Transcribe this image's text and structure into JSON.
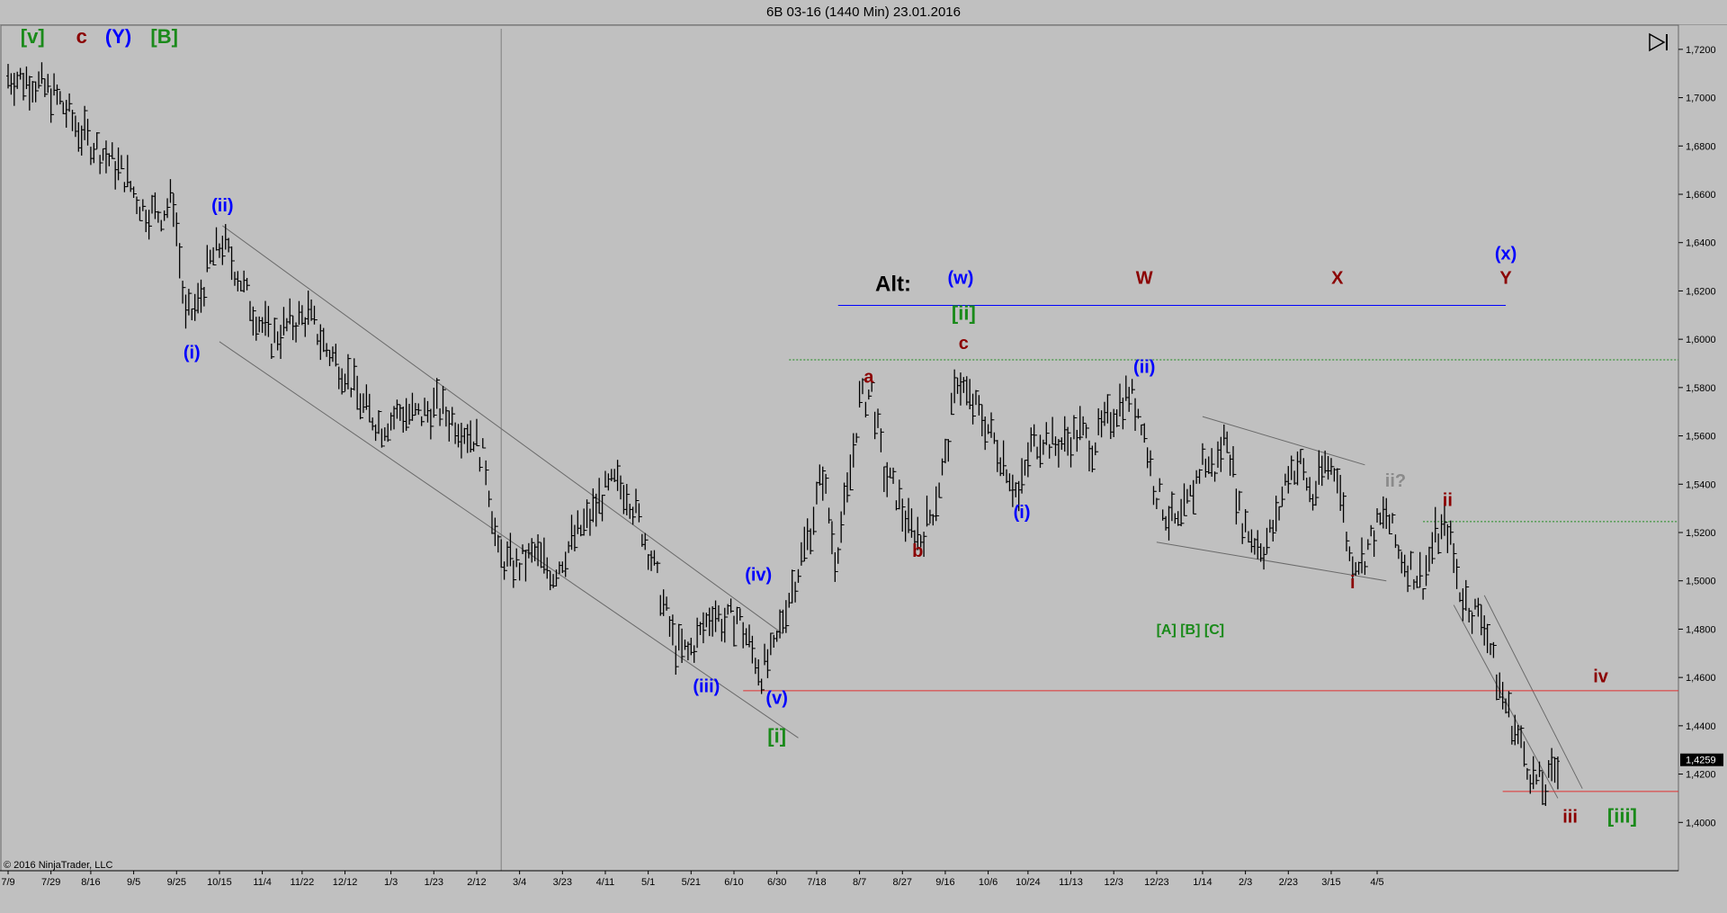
{
  "window": {
    "title": "6B 03-16 (1440 Min)  23.01.2016"
  },
  "footer": {
    "copyright": "© 2016 NinjaTrader, LLC"
  },
  "icons": {
    "play_end": "play-to-end-icon"
  },
  "colors": {
    "background": "#c0c0c0",
    "price_bars": "#000000",
    "blue_label": "#0000ff",
    "darkred_label": "#8b0000",
    "green_label": "#1a8a1a",
    "gray_label": "#8a8a8a",
    "red_line": "#e03030",
    "green_dotted": "#1a8a1a"
  },
  "chart_data": {
    "type": "bar",
    "instrument": "6B 03-16",
    "timeframe": "1440 Min",
    "date": "23.01.2016",
    "ylim": [
      1.38,
      1.73
    ],
    "y_ticks": [
      "1,7200",
      "1,7000",
      "1,6800",
      "1,6600",
      "1,6400",
      "1,6200",
      "1,6000",
      "1,5800",
      "1,5600",
      "1,5400",
      "1,5200",
      "1,5000",
      "1,4800",
      "1,4600",
      "1,4400",
      "1,4200",
      "1,4000"
    ],
    "y_tick_values": [
      1.72,
      1.7,
      1.68,
      1.66,
      1.64,
      1.62,
      1.6,
      1.58,
      1.56,
      1.54,
      1.52,
      1.5,
      1.48,
      1.46,
      1.44,
      1.42,
      1.4
    ],
    "x_ticks": [
      "7/9",
      "7/29",
      "8/16",
      "9/5",
      "9/25",
      "10/15",
      "11/4",
      "11/22",
      "12/12",
      "1/3",
      "1/23",
      "2/12",
      "3/4",
      "3/23",
      "4/11",
      "5/1",
      "5/21",
      "6/10",
      "6/30",
      "7/18",
      "8/7",
      "8/27",
      "9/16",
      "10/6",
      "10/24",
      "11/13",
      "12/3",
      "12/23",
      "1/14",
      "2/3",
      "2/23",
      "3/15",
      "4/5"
    ],
    "x_tick_index": [
      0,
      14,
      27,
      41,
      55,
      69,
      83,
      96,
      110,
      125,
      139,
      153,
      167,
      181,
      195,
      209,
      223,
      237,
      251,
      264,
      278,
      292,
      306,
      320,
      333,
      347,
      361,
      375,
      390,
      404,
      418,
      432,
      447
    ],
    "last_price": "1,4259",
    "price_path": [
      [
        0,
        1.709
      ],
      [
        8,
        1.707
      ],
      [
        16,
        1.7
      ],
      [
        24,
        1.685
      ],
      [
        32,
        1.676
      ],
      [
        38,
        1.668
      ],
      [
        44,
        1.654
      ],
      [
        50,
        1.652
      ],
      [
        54,
        1.658
      ],
      [
        58,
        1.608
      ],
      [
        62,
        1.614
      ],
      [
        66,
        1.632
      ],
      [
        70,
        1.64
      ],
      [
        74,
        1.63
      ],
      [
        80,
        1.612
      ],
      [
        86,
        1.6
      ],
      [
        92,
        1.606
      ],
      [
        98,
        1.61
      ],
      [
        104,
        1.596
      ],
      [
        110,
        1.587
      ],
      [
        116,
        1.572
      ],
      [
        122,
        1.564
      ],
      [
        128,
        1.57
      ],
      [
        134,
        1.568
      ],
      [
        140,
        1.572
      ],
      [
        146,
        1.566
      ],
      [
        152,
        1.56
      ],
      [
        156,
        1.548
      ],
      [
        160,
        1.51
      ],
      [
        166,
        1.506
      ],
      [
        172,
        1.511
      ],
      [
        178,
        1.503
      ],
      [
        184,
        1.516
      ],
      [
        190,
        1.526
      ],
      [
        194,
        1.535
      ],
      [
        198,
        1.54
      ],
      [
        202,
        1.538
      ],
      [
        206,
        1.525
      ],
      [
        210,
        1.51
      ],
      [
        214,
        1.49
      ],
      [
        218,
        1.472
      ],
      [
        222,
        1.47
      ],
      [
        226,
        1.478
      ],
      [
        230,
        1.488
      ],
      [
        234,
        1.482
      ],
      [
        238,
        1.486
      ],
      [
        242,
        1.474
      ],
      [
        246,
        1.462
      ],
      [
        250,
        1.47
      ],
      [
        254,
        1.49
      ],
      [
        258,
        1.505
      ],
      [
        262,
        1.522
      ],
      [
        266,
        1.545
      ],
      [
        270,
        1.51
      ],
      [
        274,
        1.535
      ],
      [
        278,
        1.574
      ],
      [
        282,
        1.578
      ],
      [
        286,
        1.545
      ],
      [
        290,
        1.536
      ],
      [
        294,
        1.522
      ],
      [
        298,
        1.518
      ],
      [
        302,
        1.53
      ],
      [
        306,
        1.55
      ],
      [
        310,
        1.585
      ],
      [
        314,
        1.574
      ],
      [
        318,
        1.568
      ],
      [
        322,
        1.558
      ],
      [
        326,
        1.548
      ],
      [
        330,
        1.534
      ],
      [
        334,
        1.556
      ],
      [
        338,
        1.56
      ],
      [
        342,
        1.556
      ],
      [
        346,
        1.558
      ],
      [
        350,
        1.562
      ],
      [
        354,
        1.556
      ],
      [
        358,
        1.564
      ],
      [
        362,
        1.572
      ],
      [
        366,
        1.578
      ],
      [
        370,
        1.568
      ],
      [
        374,
        1.54
      ],
      [
        378,
        1.528
      ],
      [
        382,
        1.522
      ],
      [
        386,
        1.534
      ],
      [
        390,
        1.55
      ],
      [
        394,
        1.546
      ],
      [
        398,
        1.562
      ],
      [
        402,
        1.528
      ],
      [
        406,
        1.518
      ],
      [
        410,
        1.514
      ],
      [
        414,
        1.524
      ],
      [
        418,
        1.546
      ],
      [
        422,
        1.548
      ],
      [
        426,
        1.534
      ],
      [
        430,
        1.548
      ],
      [
        434,
        1.546
      ],
      [
        438,
        1.51
      ],
      [
        442,
        1.508
      ],
      [
        446,
        1.52
      ],
      [
        450,
        1.528
      ],
      [
        454,
        1.512
      ],
      [
        458,
        1.505
      ],
      [
        462,
        1.5
      ],
      [
        466,
        1.518
      ],
      [
        470,
        1.522
      ],
      [
        474,
        1.496
      ],
      [
        478,
        1.488
      ],
      [
        482,
        1.484
      ],
      [
        486,
        1.46
      ],
      [
        490,
        1.445
      ],
      [
        494,
        1.432
      ],
      [
        498,
        1.418
      ],
      [
        502,
        1.414
      ],
      [
        506,
        1.425
      ]
    ],
    "channels": [
      {
        "x1": 70,
        "y1": 1.647,
        "x2": 253,
        "y2": 1.478
      },
      {
        "x1": 69,
        "y1": 1.599,
        "x2": 258,
        "y2": 1.435
      },
      {
        "x1": 390,
        "y1": 1.568,
        "x2": 443,
        "y2": 1.548
      },
      {
        "x1": 375,
        "y1": 1.516,
        "x2": 450,
        "y2": 1.5
      },
      {
        "x1": 472,
        "y1": 1.49,
        "x2": 506,
        "y2": 1.41
      },
      {
        "x1": 482,
        "y1": 1.494,
        "x2": 514,
        "y2": 1.414
      }
    ],
    "hlines": [
      {
        "kind": "blue",
        "y": 1.614,
        "x1": 271,
        "x2": 489
      },
      {
        "kind": "green_dotted",
        "y": 1.5915,
        "x1": 255,
        "x2": 587
      },
      {
        "kind": "green_dotted",
        "y": 1.5245,
        "x1": 462,
        "x2": 587
      },
      {
        "kind": "red",
        "y": 1.4545,
        "x1": 240,
        "x2": 587
      },
      {
        "kind": "red",
        "y": 1.4128,
        "x1": 488,
        "x2": 587
      }
    ],
    "vline_index": 161,
    "annotations": [
      {
        "text": "[v]",
        "color": "green",
        "x": 8,
        "y": 1.7225,
        "size": 22
      },
      {
        "text": "c",
        "color": "darkred",
        "x": 24,
        "y": 1.7225,
        "size": 22
      },
      {
        "text": "(Y)",
        "color": "blue",
        "x": 36,
        "y": 1.7225,
        "size": 22
      },
      {
        "text": "[B]",
        "color": "green",
        "x": 51,
        "y": 1.7225,
        "size": 22
      },
      {
        "text": "(ii)",
        "color": "blue",
        "x": 70,
        "y": 1.653,
        "size": 20
      },
      {
        "text": "(i)",
        "color": "blue",
        "x": 60,
        "y": 1.592,
        "size": 20
      },
      {
        "text": "(iii)",
        "color": "blue",
        "x": 228,
        "y": 1.454,
        "size": 20
      },
      {
        "text": "(iv)",
        "color": "blue",
        "x": 245,
        "y": 1.5,
        "size": 20
      },
      {
        "text": "(v)",
        "color": "blue",
        "x": 251,
        "y": 1.449,
        "size": 20
      },
      {
        "text": "[i]",
        "color": "green",
        "x": 251,
        "y": 1.433,
        "size": 22
      },
      {
        "text": "Alt:",
        "color": "black",
        "x": 289,
        "y": 1.62,
        "size": 24
      },
      {
        "text": "(w)",
        "color": "blue",
        "x": 311,
        "y": 1.623,
        "size": 20
      },
      {
        "text": "[ii]",
        "color": "green",
        "x": 312,
        "y": 1.608,
        "size": 22
      },
      {
        "text": "c",
        "color": "darkred",
        "x": 312,
        "y": 1.596,
        "size": 20
      },
      {
        "text": "a",
        "color": "darkred",
        "x": 281,
        "y": 1.582,
        "size": 20
      },
      {
        "text": "b",
        "color": "darkred",
        "x": 297,
        "y": 1.51,
        "size": 20
      },
      {
        "text": "W",
        "color": "darkred",
        "x": 371,
        "y": 1.623,
        "size": 20
      },
      {
        "text": "X",
        "color": "darkred",
        "x": 434,
        "y": 1.623,
        "size": 20
      },
      {
        "text": "(x)",
        "color": "blue",
        "x": 489,
        "y": 1.633,
        "size": 20
      },
      {
        "text": "Y",
        "color": "darkred",
        "x": 489,
        "y": 1.623,
        "size": 20
      },
      {
        "text": "(ii)",
        "color": "blue",
        "x": 371,
        "y": 1.586,
        "size": 20
      },
      {
        "text": "(i)",
        "color": "blue",
        "x": 331,
        "y": 1.526,
        "size": 20
      },
      {
        "text": "ii?",
        "color": "gray",
        "x": 453,
        "y": 1.539,
        "size": 20
      },
      {
        "text": "ii",
        "color": "darkred",
        "x": 470,
        "y": 1.531,
        "size": 20
      },
      {
        "text": "i",
        "color": "darkred",
        "x": 439,
        "y": 1.497,
        "size": 20
      },
      {
        "text": "[A] [B] [C]",
        "color": "green",
        "x": 386,
        "y": 1.478,
        "size": 16
      },
      {
        "text": "iv",
        "color": "darkred",
        "x": 520,
        "y": 1.458,
        "size": 20
      },
      {
        "text": "iii",
        "color": "darkred",
        "x": 510,
        "y": 1.4,
        "size": 20
      },
      {
        "text": "[iii]",
        "color": "green",
        "x": 527,
        "y": 1.4,
        "size": 22
      }
    ]
  }
}
